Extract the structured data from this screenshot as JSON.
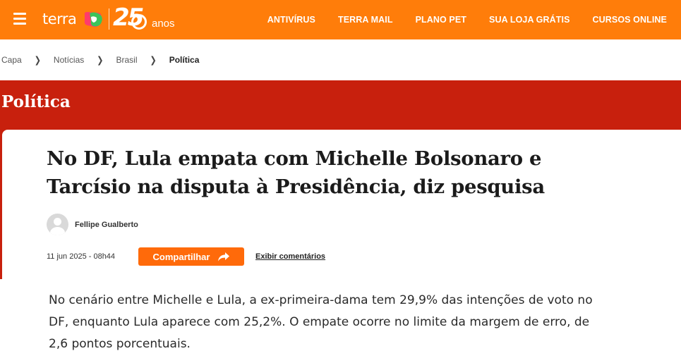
{
  "header": {
    "logo_word": "terra",
    "anniversary_number": "25",
    "anniversary_word": "anos",
    "nav": [
      "ANTIVÍRUS",
      "TERRA MAIL",
      "PLANO PET",
      "SUA LOJA GRÁTIS",
      "CURSOS ONLINE"
    ],
    "brand_color": "#ff7d0a"
  },
  "breadcrumb": [
    "Capa",
    "Notícias",
    "Brasil",
    "Política"
  ],
  "section": {
    "title": "Política",
    "color": "#c8200d"
  },
  "article": {
    "headline": "No DF, Lula empata com Michelle Bolsonaro e Tarcísio na disputa à Presidência, diz pesquisa",
    "author": "Fellipe Gualberto",
    "date": "11 jun 2025 - 08h44",
    "share_label": "Compartilhar",
    "comments_label": "Exibir comentários",
    "body": "No cenário entre Michelle e Lula, a ex-primeira-dama tem 29,9% das intenções de voto no DF, enquanto Lula aparece com 25,2%. O empate ocorre no limite da margem de erro, de 2,6 pontos porcentuais."
  },
  "icons": {
    "menu": "hamburger-icon",
    "share": "share-arrow-icon",
    "author": "avatar-placeholder-icon",
    "breadcrumb_separator": "chevron-right-icon"
  }
}
